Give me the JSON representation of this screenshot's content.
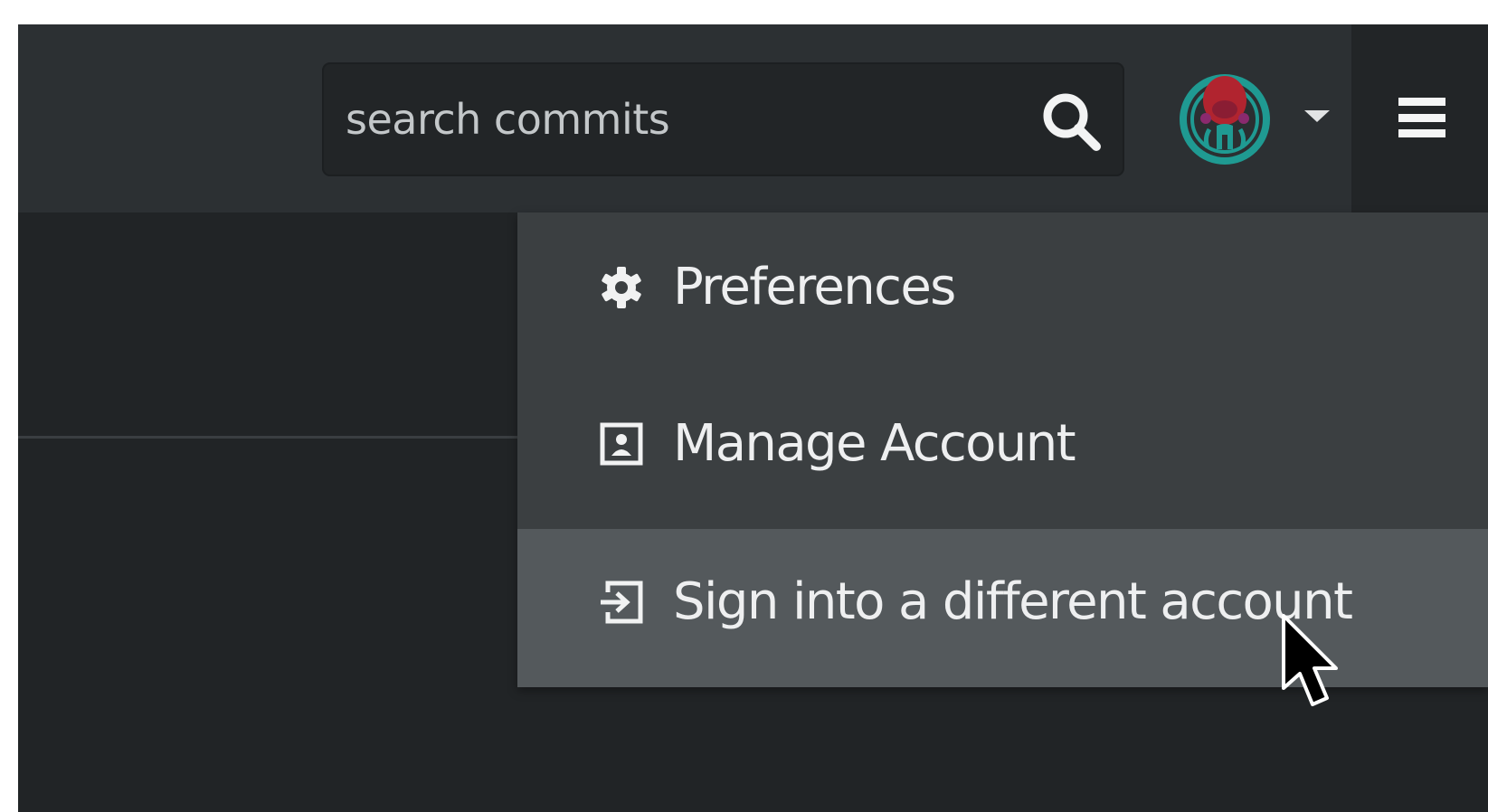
{
  "search": {
    "placeholder": "search commits",
    "icon": "search-icon"
  },
  "user_menu": {
    "avatar_icon": "octopus-avatar-icon",
    "caret_icon": "caret-down-icon"
  },
  "main_menu": {
    "icon": "hamburger-menu-icon"
  },
  "dropdown": {
    "items": [
      {
        "label": "Preferences",
        "icon": "gear-icon"
      },
      {
        "label": "Manage Account",
        "icon": "account-card-icon"
      },
      {
        "label": "Sign into a different account",
        "icon": "sign-in-icon",
        "hovered": true
      }
    ]
  },
  "colors": {
    "topbar": "#2c3033",
    "background": "#212426",
    "dropdown": "#3b3f41",
    "dropdown_hover": "#54595c",
    "text": "#eeeff0"
  }
}
